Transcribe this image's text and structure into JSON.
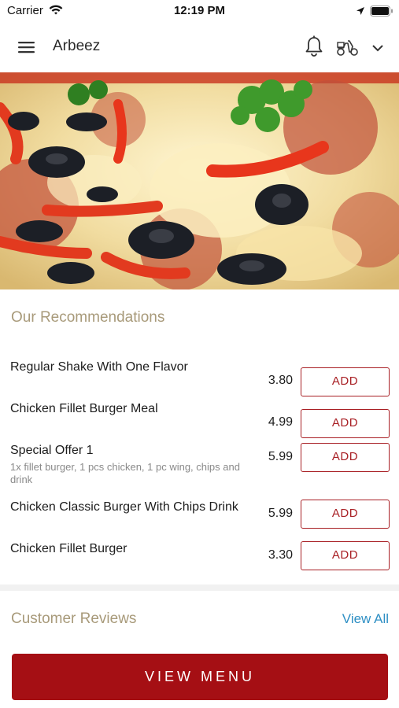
{
  "status_bar": {
    "carrier": "Carrier",
    "time": "12:19 PM"
  },
  "nav": {
    "title": "Arbeez",
    "icons": [
      "hamburger-menu-icon",
      "bell-icon",
      "scooter-icon",
      "chevron-down-icon"
    ]
  },
  "hero": {
    "image": "pizza-photo"
  },
  "recommendations": {
    "title": "Our Recommendations",
    "items": [
      {
        "name": "Regular Shake With One Flavor",
        "description": "",
        "price": "3.80",
        "button": "ADD"
      },
      {
        "name": "Chicken Fillet Burger Meal",
        "description": "",
        "price": "4.99",
        "button": "ADD"
      },
      {
        "name": "Special Offer 1",
        "description": "1x fillet burger, 1 pcs chicken, 1 pc wing, chips and drink",
        "price": "5.99",
        "button": "ADD"
      },
      {
        "name": "Chicken Classic Burger With Chips Drink",
        "description": "",
        "price": "5.99",
        "button": "ADD"
      },
      {
        "name": "Chicken Fillet Burger",
        "description": "",
        "price": "3.30",
        "button": "ADD"
      }
    ]
  },
  "reviews": {
    "title": "Customer Reviews",
    "view_all": "View All"
  },
  "footer": {
    "view_menu": "VIEW MENU"
  },
  "colors": {
    "accent": "#a50f14",
    "section_title": "#a89a7a",
    "link": "#2e8fc4"
  }
}
